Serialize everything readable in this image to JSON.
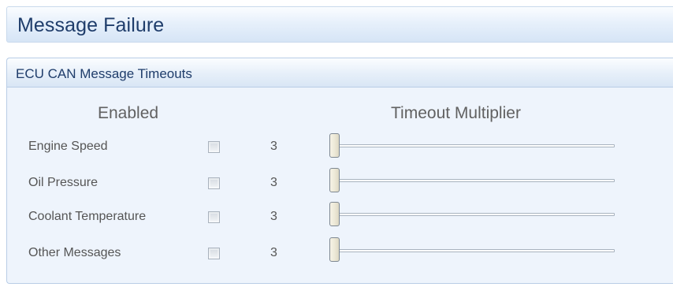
{
  "header": {
    "title": "Message Failure"
  },
  "group": {
    "title": "ECU CAN Message Timeouts",
    "enabled_heading": "Enabled",
    "multiplier_heading": "Timeout Multiplier",
    "rows": [
      {
        "label": "Engine Speed",
        "enabled": false,
        "multiplier": "3",
        "slider_position": 0
      },
      {
        "label": "Oil Pressure",
        "enabled": false,
        "multiplier": "3",
        "slider_position": 0
      },
      {
        "label": "Coolant Temperature",
        "enabled": false,
        "multiplier": "3",
        "slider_position": 0
      },
      {
        "label": "Other Messages",
        "enabled": false,
        "multiplier": "3",
        "slider_position": 0
      }
    ]
  },
  "colors": {
    "title_text": "#1f3d6b",
    "panel_background": "#eef4fc",
    "border": "#b9cde6",
    "label_text": "#555555"
  },
  "icons": {
    "checkbox": "unchecked-checkbox-icon",
    "slider_thumb": "slider-thumb-icon"
  }
}
